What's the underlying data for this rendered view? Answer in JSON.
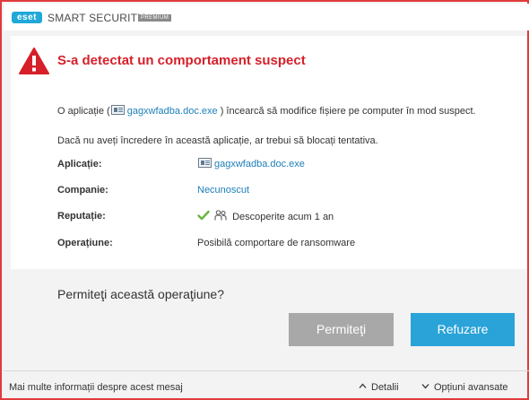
{
  "titlebar": {
    "logo_text": "eset",
    "product": "SMART SECURITY",
    "edition": "PREMIUM"
  },
  "alert": {
    "icon": "warning-triangle-icon",
    "headline": "S-a detectat un comportament suspect",
    "description_prefix": "O aplicație (",
    "app_name": "gagxwfadba.doc.exe",
    "description_suffix": ") încearcă să modifice fișiere pe computer în mod suspect.",
    "advice": "Dacă nu aveți încredere în această aplicație, ar trebui să blocați tentativa."
  },
  "details": {
    "application_label": "Aplicație:",
    "application_value": "gagxwfadba.doc.exe",
    "company_label": "Companie:",
    "company_value": "Necunoscut",
    "reputation_label": "Reputație:",
    "reputation_value": "Descoperite acum 1 an",
    "operation_label": "Operațiune:",
    "operation_value": "Posibilă comportare de ransomware"
  },
  "prompt": {
    "question": "Permiteţi această operaţiune?",
    "allow_label": "Permiteţi",
    "deny_label": "Refuzare"
  },
  "footer": {
    "more_info": "Mai multe informații despre acest mesaj",
    "details_toggle": "Detalii",
    "advanced_toggle": "Opțiuni avansate"
  },
  "colors": {
    "border": "#e23b3b",
    "headline": "#d6202a",
    "link": "#1e7fb8",
    "allow_button": "#a8a8a8",
    "deny_button": "#2aa3d8",
    "check": "#6cb33f"
  }
}
